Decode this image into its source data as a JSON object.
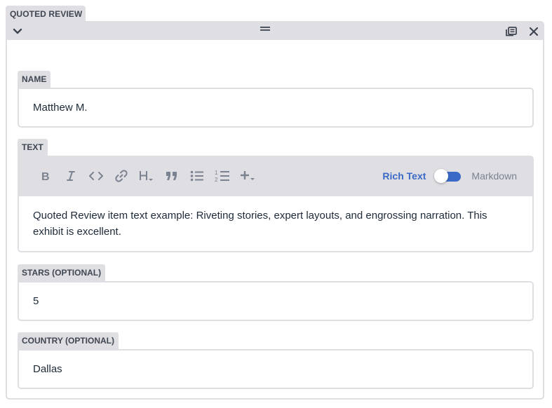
{
  "widget": {
    "title": "QUOTED REVIEW",
    "icons": {
      "collapse": "chevron-down-icon",
      "drag": "drag-handle-icon",
      "duplicate": "duplicate-icon",
      "close": "close-icon"
    }
  },
  "fields": {
    "name": {
      "label": "NAME",
      "value": "Matthew M."
    },
    "text": {
      "label": "TEXT",
      "toolbar": {
        "buttons": [
          "bold-icon",
          "italic-icon",
          "code-icon",
          "link-icon",
          "heading-icon",
          "quote-icon",
          "bulleted-list-icon",
          "numbered-list-icon",
          "add-component-icon"
        ],
        "rich_text_label": "Rich Text",
        "markdown_label": "Markdown",
        "mode_toggle_on": true
      },
      "value": "Quoted Review item text example: Riveting stories, expert layouts, and engrossing narration. This exhibit is excellent."
    },
    "stars": {
      "label": "STARS (OPTIONAL)",
      "value": "5"
    },
    "country": {
      "label": "COUNTRY (OPTIONAL)",
      "value": "Dallas"
    }
  },
  "colors": {
    "accent": "#3a69c7",
    "panel": "#dfdfe3",
    "text": "#1e2a38"
  }
}
